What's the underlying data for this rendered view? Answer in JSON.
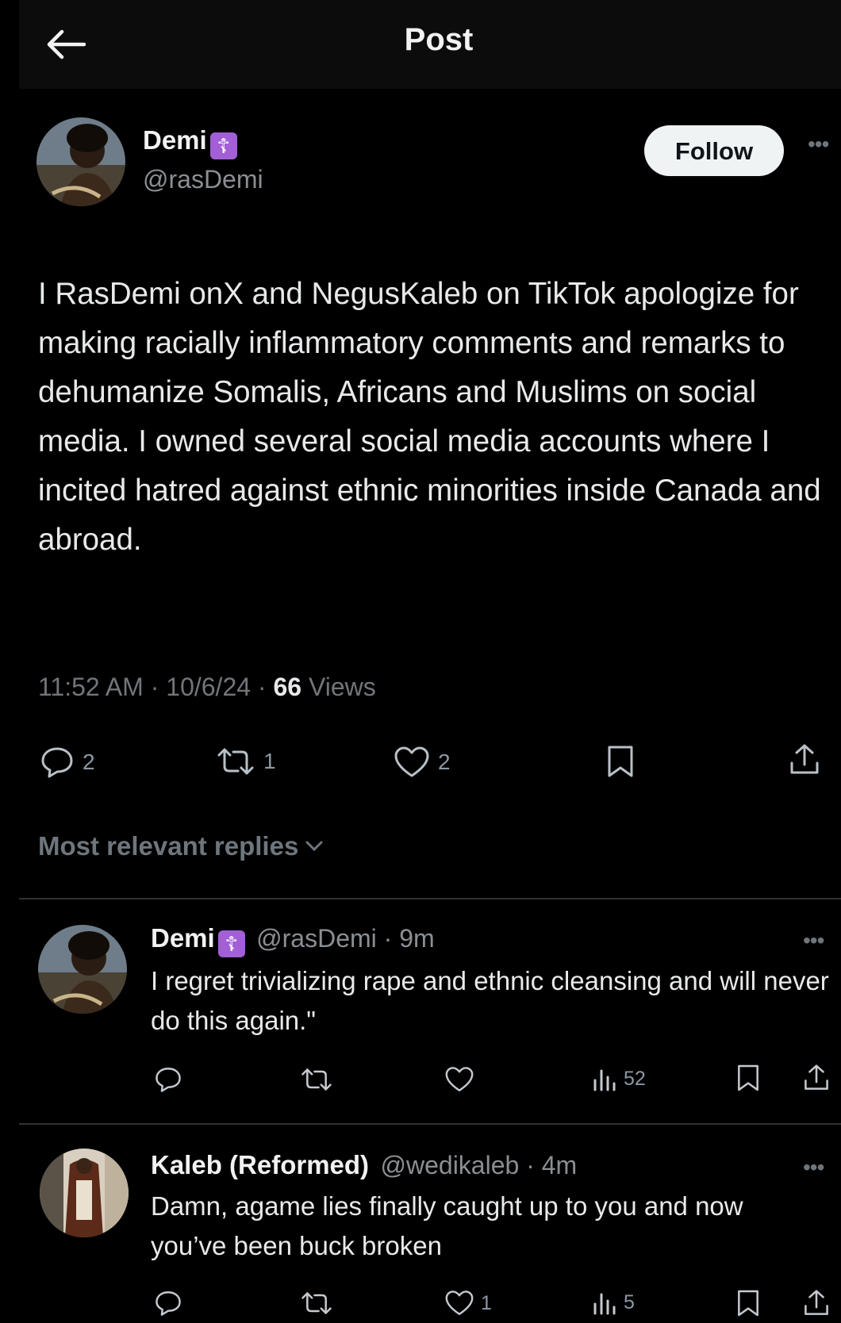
{
  "header": {
    "title": "Post"
  },
  "post": {
    "author_name": "Demi",
    "badge_symbol": "☦",
    "handle": "@rasDemi",
    "follow_label": "Follow",
    "text": "I RasDemi onX and NegusKaleb on TikTok apologize for making racially inflammatory comments and remarks to dehumanize Somalis, Africans and Muslims on social media. I owned several social media accounts where I incited hatred against ethnic minorities inside Canada and abroad.",
    "meta_prefix": "11:52 AM · 10/6/24 · ",
    "views_count": "66",
    "views_label": " Views",
    "stats": {
      "replies": "2",
      "reposts": "1",
      "likes": "2"
    }
  },
  "replies_filter": {
    "label": "Most relevant replies"
  },
  "replies": [
    {
      "author_name": "Demi",
      "badge_symbol": "☦",
      "handle_time": "@rasDemi · 9m",
      "text": "I regret trivializing rape and ethnic cleansing and will never do this again.\"",
      "views": "52"
    },
    {
      "author_name": "Kaleb (Reformed)",
      "handle_time": "@wedikaleb · 4m",
      "text": "Damn, agame lies finally caught up to you and now you’ve been buck broken",
      "likes": "1",
      "views": "5"
    }
  ],
  "colors": {
    "background": "#000000",
    "badge": "#a25fd6",
    "muted": "#71767b"
  }
}
